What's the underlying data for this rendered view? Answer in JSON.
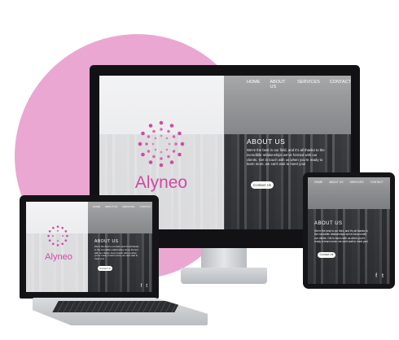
{
  "site": {
    "brand": "Alyneo",
    "nav": [
      "HOME",
      "ABOUT US",
      "SERVICES",
      "CONTACT"
    ],
    "about_title": "ABOUT US",
    "about_body": "We're the best in our field, and it's all thanks to the incredible relationships we've formed with our clients. Get in touch with us when you're ready to learn more; we can't wait to meet you!",
    "cta": "Contact Us"
  },
  "colors": {
    "accent": "#cf4aa2",
    "blob": "#eaa7d2",
    "device": "#1c1c1e"
  },
  "icons": [
    "facebook-icon",
    "twitter-icon"
  ]
}
